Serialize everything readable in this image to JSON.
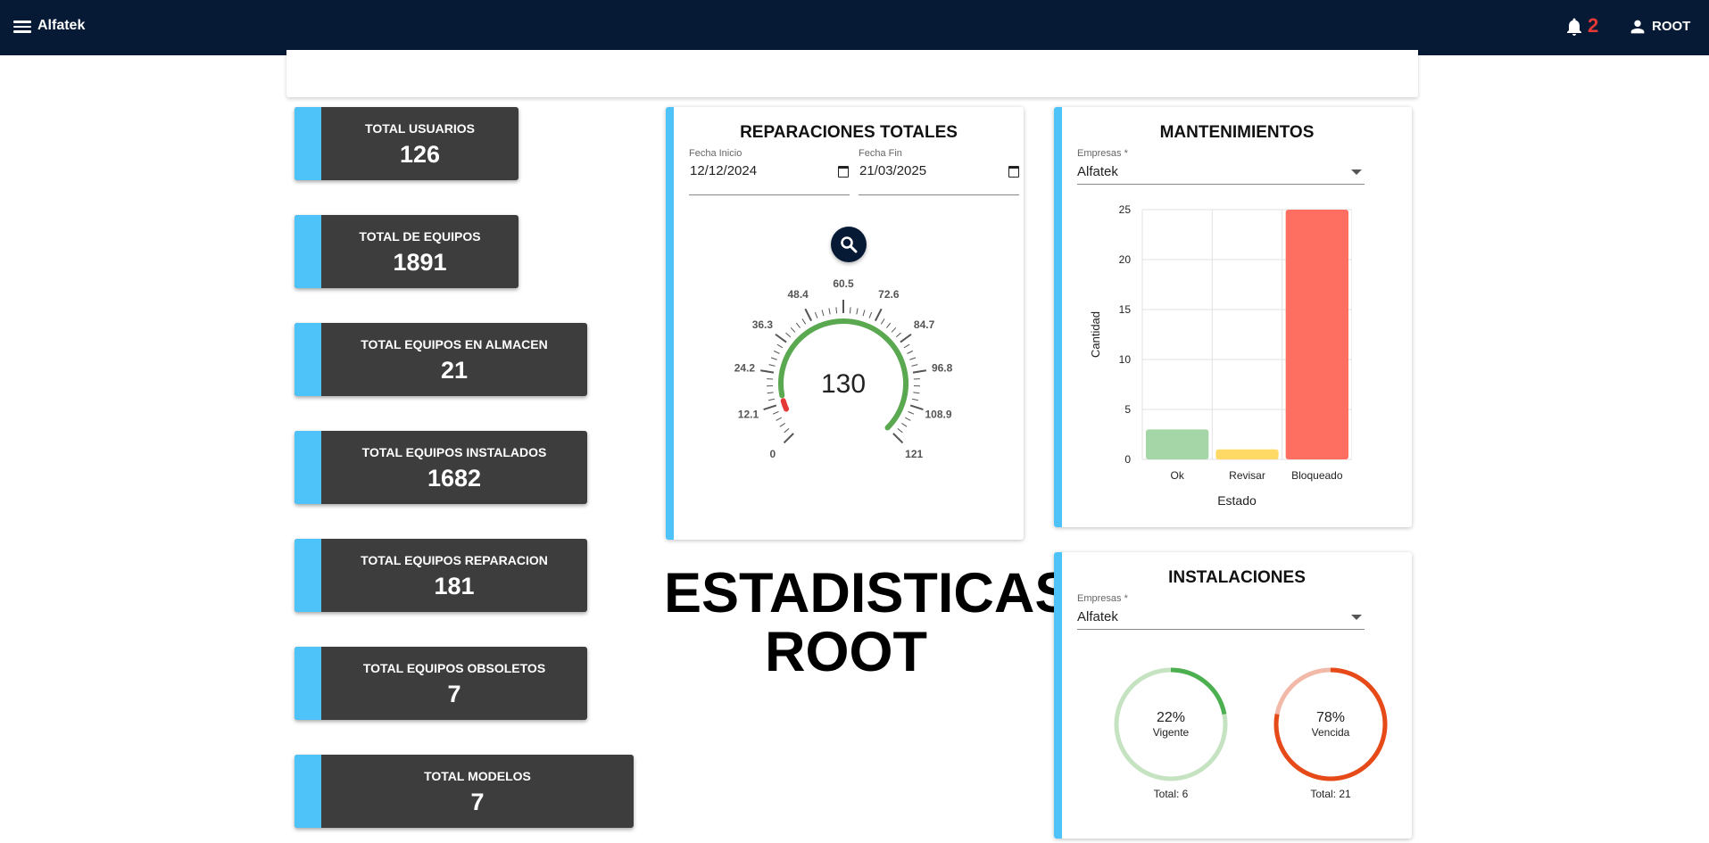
{
  "header": {
    "brand": "Alfatek",
    "notification_count": "2",
    "user": "ROOT",
    "icons": [
      "menu-icon",
      "bell-icon",
      "user-icon"
    ]
  },
  "stats": [
    {
      "label": "TOTAL USUARIOS",
      "value": "126"
    },
    {
      "label": "TOTAL DE EQUIPOS",
      "value": "1891"
    },
    {
      "label": "TOTAL EQUIPOS EN ALMACEN",
      "value": "21"
    },
    {
      "label": "TOTAL EQUIPOS INSTALADOS",
      "value": "1682"
    },
    {
      "label": "TOTAL EQUIPOS REPARACION",
      "value": "181"
    },
    {
      "label": "TOTAL EQUIPOS OBSOLETOS",
      "value": "7"
    },
    {
      "label": "TOTAL MODELOS",
      "value": "7"
    }
  ],
  "reparaciones": {
    "title": "REPARACIONES TOTALES",
    "fecha_inicio_label": "Fecha Inicio",
    "fecha_inicio": "12/12/2024",
    "fecha_fin_label": "Fecha Fin",
    "fecha_fin": "21/03/2025",
    "gauge": {
      "value": "130",
      "min": 0,
      "max": 121,
      "ticks": [
        "0",
        "12.1",
        "24.2",
        "36.3",
        "48.4",
        "60.5",
        "72.6",
        "84.7",
        "96.8",
        "108.9",
        "121"
      ]
    }
  },
  "page_title_line1": "ESTADISTICAS",
  "page_title_line2": "ROOT",
  "mantenimientos": {
    "title": "MANTENIMIENTOS",
    "empresas_label": "Empresas *",
    "empresa": "Alfatek"
  },
  "instalaciones": {
    "title": "INSTALACIONES",
    "empresas_label": "Empresas *",
    "empresa": "Alfatek",
    "donuts": [
      {
        "percent": "22%",
        "label": "Vigente",
        "total": "Total: 6",
        "fraction": 0.22,
        "color": "#4caf50",
        "track": "#c5e3c1"
      },
      {
        "percent": "78%",
        "label": "Vencida",
        "total": "Total: 21",
        "fraction": 0.78,
        "color": "#e64a19",
        "track": "#f2b9a8"
      }
    ]
  },
  "chart_data": {
    "type": "bar",
    "categories": [
      "Ok",
      "Revisar",
      "Bloqueado"
    ],
    "values": [
      3,
      1,
      25
    ],
    "colors": [
      "#a5d6a7",
      "#ffd966",
      "#ff6f61"
    ],
    "xlabel": "Estado",
    "ylabel": "Cantidad",
    "ylim": [
      0,
      25
    ],
    "yticks": [
      "0",
      "5",
      "10",
      "15",
      "20",
      "25"
    ],
    "grid": true
  }
}
